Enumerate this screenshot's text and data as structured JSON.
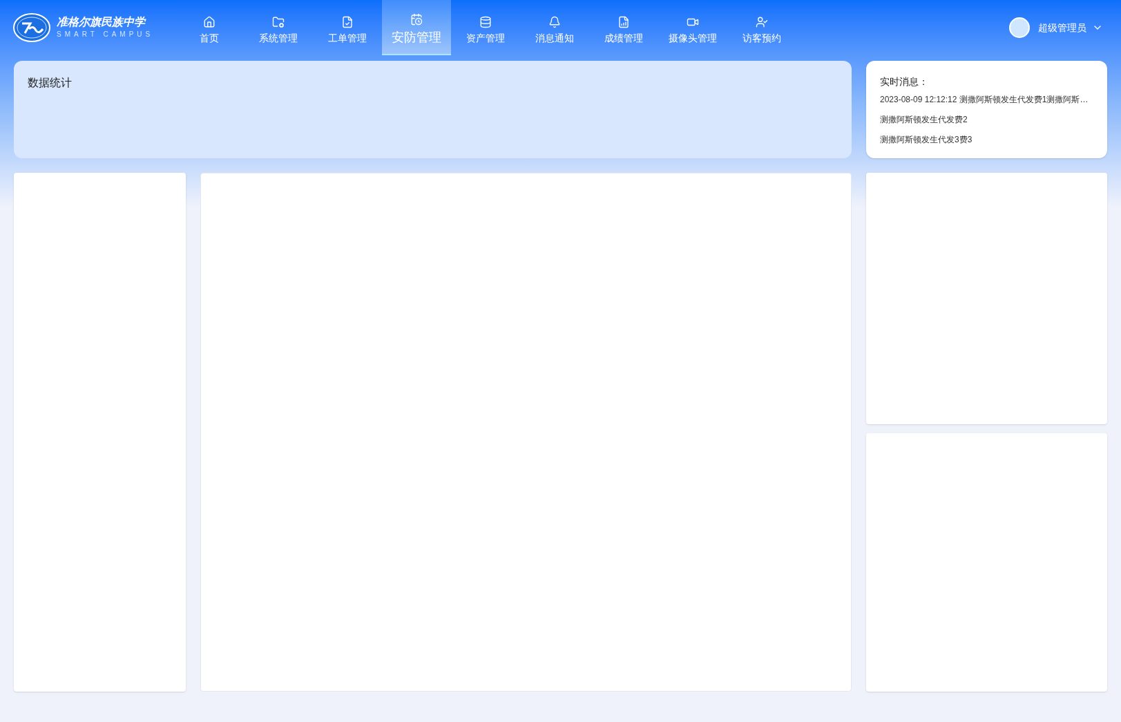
{
  "brand": {
    "name": "准格尔旗民族中学",
    "subtitle": "SMART CAMPUS"
  },
  "nav": [
    {
      "label": "首页",
      "selected": false
    },
    {
      "label": "系统管理",
      "selected": false
    },
    {
      "label": "工单管理",
      "selected": false
    },
    {
      "label": "安防管理",
      "selected": true
    },
    {
      "label": "资产管理",
      "selected": false
    },
    {
      "label": "消息通知",
      "selected": false
    },
    {
      "label": "成绩管理",
      "selected": false
    },
    {
      "label": "摄像头管理",
      "selected": false
    },
    {
      "label": "访客预约",
      "selected": false
    }
  ],
  "user": {
    "name": "超级管理员"
  },
  "stats_panel": {
    "title": "数据统计"
  },
  "messages": {
    "title": "实时消息：",
    "items": [
      "2023-08-09 12:12:12 测撒阿斯顿发生代发费1测撒阿斯…",
      "测撒阿斯顿发生代发费2",
      "测撒阿斯顿发生代发3费3"
    ]
  }
}
